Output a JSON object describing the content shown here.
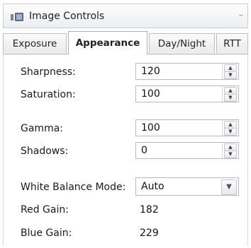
{
  "window": {
    "title": "Image Controls",
    "collapse_glyph": "–"
  },
  "tabs": [
    {
      "label": "Exposure",
      "active": false
    },
    {
      "label": "Appearance",
      "active": true
    },
    {
      "label": "Day/Night",
      "active": false
    },
    {
      "label": "RTT",
      "active": false
    }
  ],
  "fields": {
    "sharpness": {
      "label": "Sharpness:",
      "value": "120"
    },
    "saturation": {
      "label": "Saturation:",
      "value": "100"
    },
    "gamma": {
      "label": "Gamma:",
      "value": "100"
    },
    "shadows": {
      "label": "Shadows:",
      "value": "0"
    },
    "white_balance_mode": {
      "label": "White Balance Mode:",
      "value": "Auto"
    },
    "red_gain": {
      "label": "Red Gain:",
      "value": "182"
    },
    "blue_gain": {
      "label": "Blue Gain:",
      "value": "229"
    }
  },
  "icons": {
    "title": "camera-icon",
    "spin_up": "arrow-up-icon",
    "spin_down": "arrow-down-icon",
    "dropdown": "chevron-down-icon",
    "collapse": "collapse-icon"
  },
  "colors": {
    "border": "#b7bcc4",
    "active_tab_bg": "#ffffff",
    "tab_bg": "#ececee"
  }
}
